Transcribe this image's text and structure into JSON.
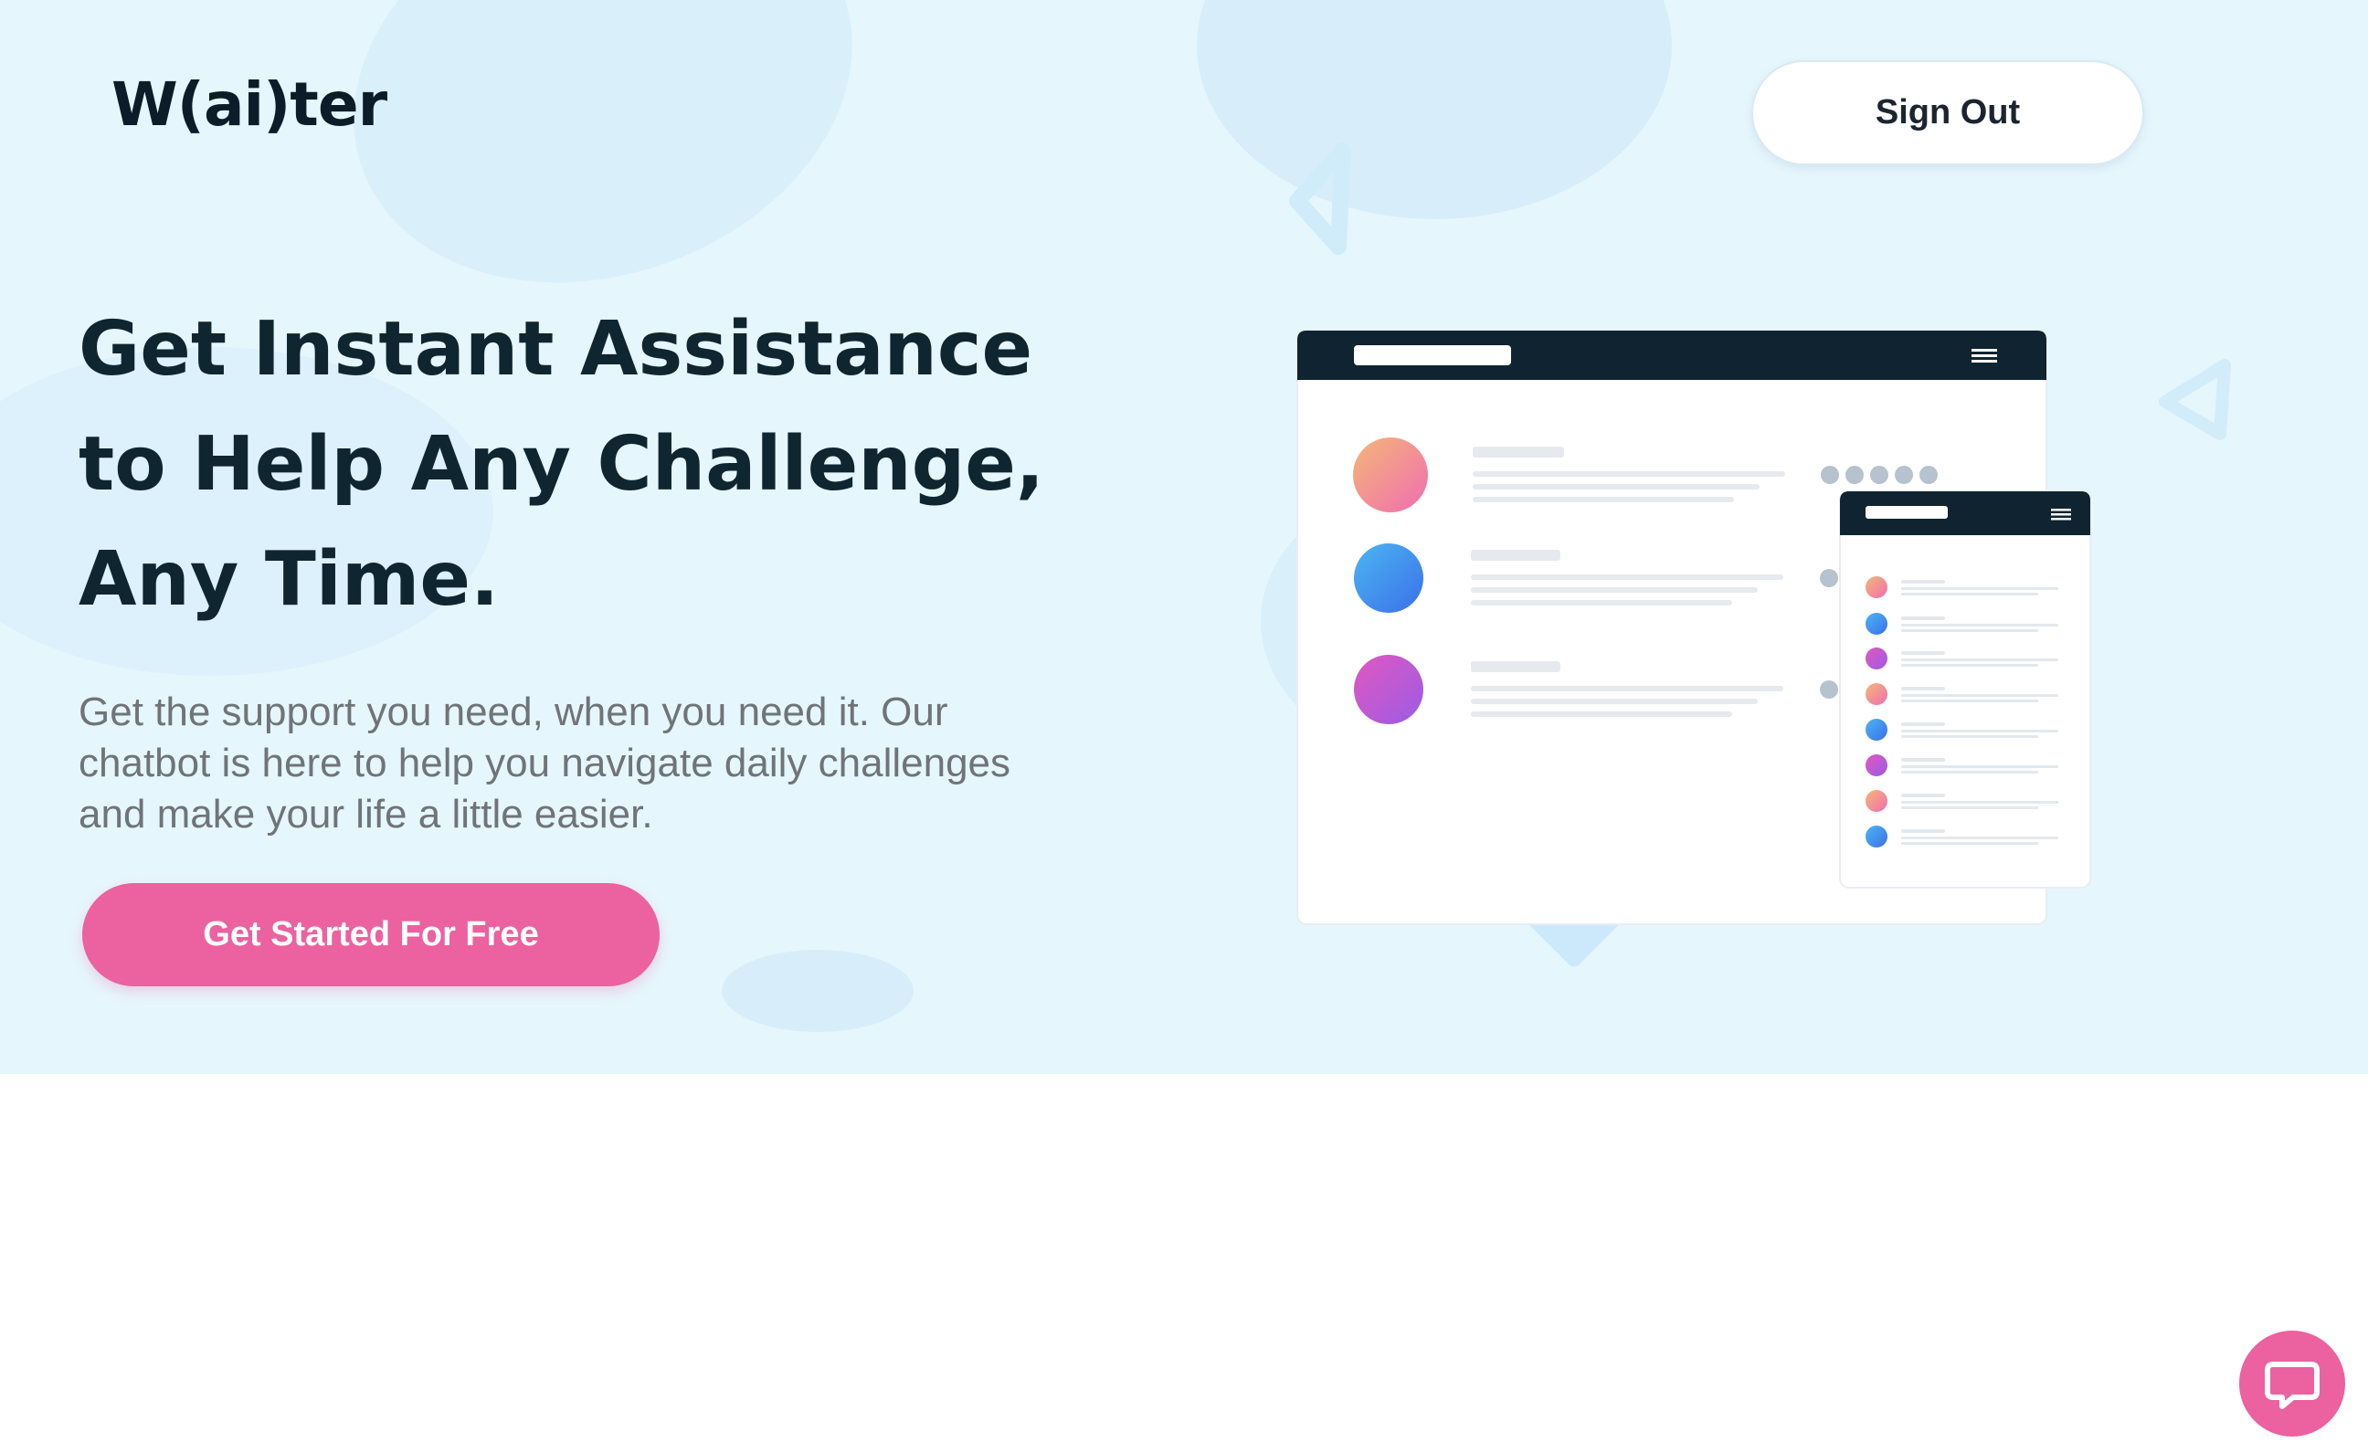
{
  "brand": {
    "logo_text": "W(ai)ter"
  },
  "header": {
    "signout_label": "Sign Out"
  },
  "hero": {
    "headline": "Get Instant Assistance to Help Any Challenge, Any Time.",
    "subtext": "Get the support you need, when you need it. Our chatbot is here to help you navigate daily challenges and make your life a little easier.",
    "cta_label": "Get Started For Free"
  },
  "icons": {
    "illustration": "chat-app-mockup-illustration",
    "chat_fab": "chat-bubble-icon"
  },
  "colors": {
    "hero_background": "#e6f6fd",
    "accent_pink": "#ec619f",
    "heading_dark": "#0f2530",
    "body_gray": "#6f7478",
    "mockup_header": "#0f2430"
  }
}
